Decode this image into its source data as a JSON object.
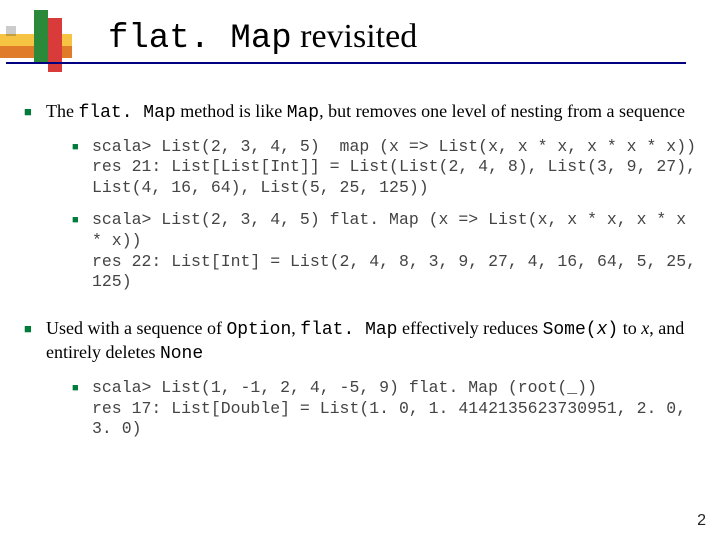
{
  "title": {
    "code": "flat. Map",
    "rest": " revisited"
  },
  "bullets": [
    {
      "pre": "The ",
      "code1": "flat. Map",
      "mid1": " method is like ",
      "code2": "Map",
      "post": ", but removes one level of nesting from a sequence",
      "sub": [
        "scala> List(2, 3, 4, 5)  map (x => List(x, x * x, x * x * x))\nres 21: List[List[Int]] = List(List(2, 4, 8), List(3, 9, 27), List(4, 16, 64), List(5, 25, 125))",
        "scala> List(2, 3, 4, 5) flat. Map (x => List(x, x * x, x * x * x))\nres 22: List[Int] = List(2, 4, 8, 3, 9, 27, 4, 16, 64, 5, 25, 125)"
      ]
    },
    {
      "pre": "Used with a sequence of ",
      "code1": "Option",
      "mid1": ", ",
      "code2": "flat. Map",
      "mid2": " effectively reduces ",
      "code3": "Some(",
      "ital": "x",
      "code3b": ")",
      "mid3": " to ",
      "ital2": "x",
      "mid4": ",  and entirely deletes ",
      "code4": "None",
      "sub": [
        "scala> List(1, -1, 2, 4, -5, 9) flat. Map (root(_))\nres 17: List[Double] = List(1. 0, 1. 4142135623730951, 2. 0, 3. 0)"
      ]
    }
  ],
  "page": "2"
}
